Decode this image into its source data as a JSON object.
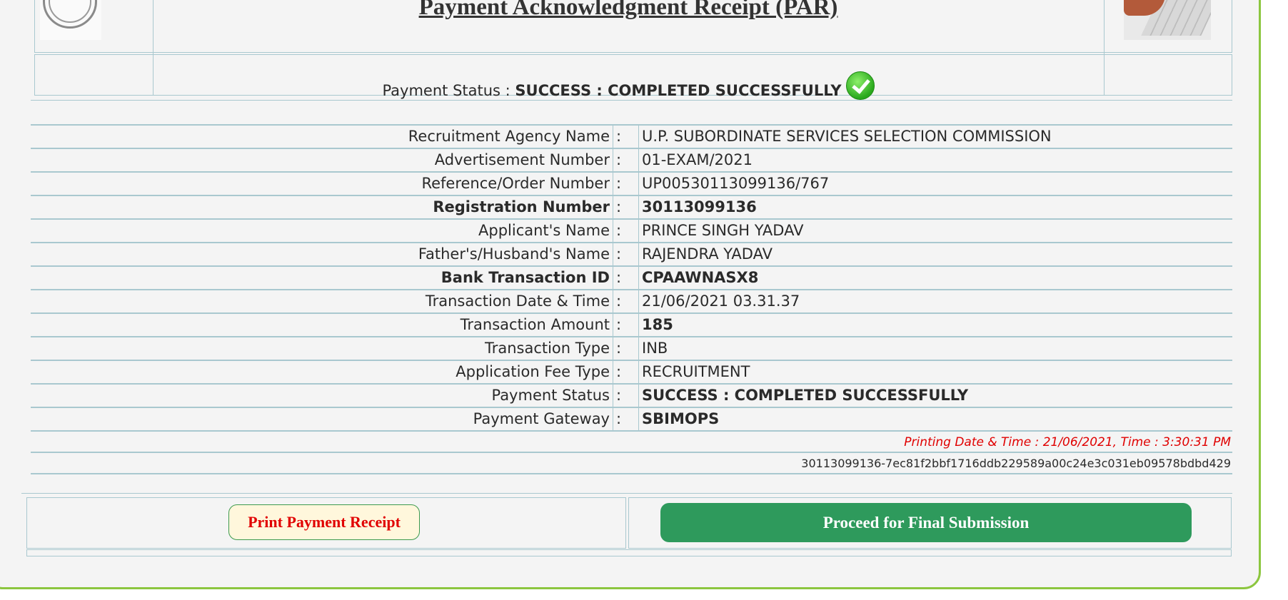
{
  "header": {
    "title": "Payment Acknowledgment Receipt (PAR)",
    "status_prefix": "Payment Status : ",
    "status_value": "SUCCESS : COMPLETED SUCCESSFULLY",
    "status_icon": "check-circle-icon"
  },
  "details": [
    {
      "label": "Recruitment Agency Name",
      "sep": ":",
      "value": "U.P. SUBORDINATE SERVICES SELECTION COMMISSION",
      "bold": false
    },
    {
      "label": "Advertisement Number",
      "sep": ":",
      "value": "01-EXAM/2021",
      "bold": false
    },
    {
      "label": "Reference/Order Number",
      "sep": ":",
      "value": "UP00530113099136/767",
      "bold": false
    },
    {
      "label": "Registration Number",
      "sep": ":",
      "value": "30113099136",
      "bold": true
    },
    {
      "label": "Applicant's Name",
      "sep": ":",
      "value": "PRINCE SINGH YADAV",
      "bold": false
    },
    {
      "label": "Father's/Husband's Name",
      "sep": ":",
      "value": "RAJENDRA YADAV",
      "bold": false
    },
    {
      "label": "Bank Transaction ID",
      "sep": ":",
      "value": "CPAAWNASX8",
      "bold": true
    },
    {
      "label": "Transaction Date & Time",
      "sep": ":",
      "value": "21/06/2021 03.31.37",
      "bold": false
    },
    {
      "label": "Transaction Amount",
      "sep": ":",
      "value": "185",
      "bold": false,
      "value_bold": true
    },
    {
      "label": "Transaction Type",
      "sep": ":",
      "value": "INB",
      "bold": false
    },
    {
      "label": "Application Fee Type",
      "sep": ":",
      "value": "RECRUITMENT",
      "bold": false
    },
    {
      "label": "Payment Status",
      "sep": ":",
      "value": "SUCCESS : COMPLETED SUCCESSFULLY",
      "bold": false,
      "value_bold": true
    },
    {
      "label": "Payment Gateway",
      "sep": ":",
      "value": "SBIMOPS",
      "bold": false,
      "value_bold": true
    }
  ],
  "printing": "Printing Date & Time : 21/06/2021, Time : 3:30:31 PM",
  "hash": "30113099136-7ec81f2bbf1716ddb229589a00c24e3c031eb09578bdbd429",
  "buttons": {
    "print_label": "Print Payment Receipt",
    "final_label": "Proceed for Final Submission"
  },
  "colors": {
    "frame_border": "#8cc63f",
    "print_text": "#e10000",
    "final_bg": "#2e9a5c",
    "printing_text": "#e00000"
  }
}
